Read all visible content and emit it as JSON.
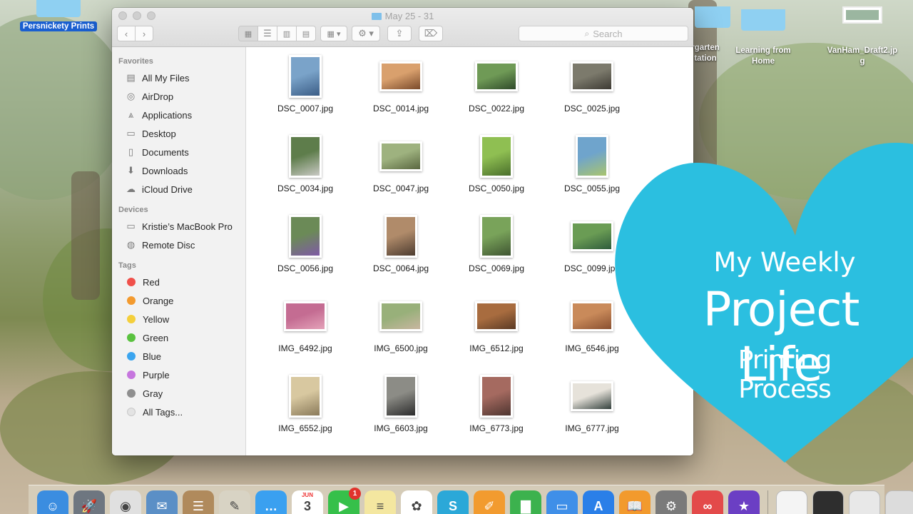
{
  "desktop": {
    "icons": [
      {
        "label": "Persnickety Prints",
        "selected": true
      },
      {
        "label": "rgarten\ntation"
      },
      {
        "label": "Learning from\nHome"
      },
      {
        "label": "VanHam_Draft2.jp\ng"
      }
    ]
  },
  "window": {
    "title": "May 25 - 31",
    "search_placeholder": "Search"
  },
  "sidebar": {
    "favorites_heading": "Favorites",
    "favorites": [
      {
        "label": "All My Files",
        "icon": "all-files-icon"
      },
      {
        "label": "AirDrop",
        "icon": "airdrop-icon"
      },
      {
        "label": "Applications",
        "icon": "applications-icon"
      },
      {
        "label": "Desktop",
        "icon": "desktop-icon"
      },
      {
        "label": "Documents",
        "icon": "documents-icon"
      },
      {
        "label": "Downloads",
        "icon": "downloads-icon"
      },
      {
        "label": "iCloud Drive",
        "icon": "icloud-icon"
      }
    ],
    "devices_heading": "Devices",
    "devices": [
      {
        "label": "Kristie’s MacBook Pro",
        "icon": "laptop-icon"
      },
      {
        "label": "Remote Disc",
        "icon": "disc-icon"
      }
    ],
    "tags_heading": "Tags",
    "tags": [
      {
        "label": "Red",
        "color": "#f0504a"
      },
      {
        "label": "Orange",
        "color": "#f39a2e"
      },
      {
        "label": "Yellow",
        "color": "#f4cf3b"
      },
      {
        "label": "Green",
        "color": "#5ac23f"
      },
      {
        "label": "Blue",
        "color": "#3ba5ef"
      },
      {
        "label": "Purple",
        "color": "#c676de"
      },
      {
        "label": "Gray",
        "color": "#8f8f8f"
      },
      {
        "label": "All Tags...",
        "color": "#e3e3e3"
      }
    ]
  },
  "files": [
    {
      "name": "DSC_0007.jpg",
      "orientation": "portrait",
      "colors": [
        "#7aa3c9",
        "#3b5d86"
      ]
    },
    {
      "name": "DSC_0014.jpg",
      "orientation": "landscape",
      "colors": [
        "#d9a06d",
        "#7a4a2b"
      ]
    },
    {
      "name": "DSC_0022.jpg",
      "orientation": "landscape",
      "colors": [
        "#6f9a56",
        "#2f4a2a"
      ]
    },
    {
      "name": "DSC_0025.jpg",
      "orientation": "landscape",
      "colors": [
        "#7c7a6c",
        "#3d3a33"
      ]
    },
    {
      "name": "DSC_0034.jpg",
      "orientation": "portrait",
      "colors": [
        "#5e7d4b",
        "#c9c9c4"
      ]
    },
    {
      "name": "DSC_0047.jpg",
      "orientation": "landscape",
      "colors": [
        "#9eb27f",
        "#5a6740"
      ]
    },
    {
      "name": "DSC_0050.jpg",
      "orientation": "portrait",
      "colors": [
        "#8fbf52",
        "#4a6f2c"
      ]
    },
    {
      "name": "DSC_0055.jpg",
      "orientation": "portrait",
      "colors": [
        "#6fa4cc",
        "#a9c46e"
      ]
    },
    {
      "name": "DSC_0056.jpg",
      "orientation": "portrait",
      "colors": [
        "#6b8a57",
        "#7f5aa6"
      ]
    },
    {
      "name": "DSC_0064.jpg",
      "orientation": "portrait",
      "colors": [
        "#b08b6a",
        "#4d3c30"
      ]
    },
    {
      "name": "DSC_0069.jpg",
      "orientation": "portrait",
      "colors": [
        "#79a35a",
        "#3f5532"
      ]
    },
    {
      "name": "DSC_0099.jpg",
      "orientation": "landscape",
      "colors": [
        "#6a9c54",
        "#2f5c3c"
      ]
    },
    {
      "name": "IMG_6492.jpg",
      "orientation": "landscape",
      "colors": [
        "#c46c92",
        "#e4a2b9"
      ]
    },
    {
      "name": "IMG_6500.jpg",
      "orientation": "landscape",
      "colors": [
        "#98b07a",
        "#c8b6a0"
      ]
    },
    {
      "name": "IMG_6512.jpg",
      "orientation": "landscape",
      "colors": [
        "#a86c3f",
        "#5a3a24"
      ]
    },
    {
      "name": "IMG_6546.jpg",
      "orientation": "landscape",
      "colors": [
        "#c98a5a",
        "#8a5030"
      ]
    },
    {
      "name": "IMG_6552.jpg",
      "orientation": "portrait",
      "colors": [
        "#d8c8a0",
        "#8a7a5a"
      ]
    },
    {
      "name": "IMG_6603.jpg",
      "orientation": "portrait",
      "colors": [
        "#8c8c86",
        "#2c2c2c"
      ]
    },
    {
      "name": "IMG_6773.jpg",
      "orientation": "portrait",
      "colors": [
        "#a56a60",
        "#4e3530"
      ]
    },
    {
      "name": "IMG_6777.jpg",
      "orientation": "landscape",
      "colors": [
        "#e6e2da",
        "#33403c"
      ]
    }
  ],
  "overlay": {
    "line1": "My Weekly",
    "line2": "Project Life",
    "line3": "Printing Process",
    "heart_color": "#2bbfe0"
  },
  "dock": {
    "apps": [
      {
        "name": "finder-app",
        "color": "#3b8de0",
        "glyph": "☺"
      },
      {
        "name": "launchpad-app",
        "color": "#6e7680",
        "glyph": "🚀"
      },
      {
        "name": "chrome-app",
        "color": "#e0e0e0",
        "glyph": "◉"
      },
      {
        "name": "mail-app",
        "color": "#5b8fc6",
        "glyph": "✉"
      },
      {
        "name": "contacts-app",
        "color": "#b08a5c",
        "glyph": "☰"
      },
      {
        "name": "notes-app",
        "color": "#d8d3c4",
        "glyph": "✎"
      },
      {
        "name": "messages-app",
        "color": "#3aa0f0",
        "glyph": "…"
      },
      {
        "name": "calendar-app",
        "color": "#ffffff",
        "glyph": "3",
        "label": "JUN"
      },
      {
        "name": "facetime-app",
        "color": "#36c04a",
        "glyph": "▶",
        "badge": "1"
      },
      {
        "name": "stickies-app",
        "color": "#f4e7a0",
        "glyph": "≡"
      },
      {
        "name": "photos-app",
        "color": "#ffffff",
        "glyph": "✿"
      },
      {
        "name": "silhouette-app",
        "color": "#2ba8d8",
        "glyph": "S"
      },
      {
        "name": "pages-app",
        "color": "#f29b2f",
        "glyph": "✐"
      },
      {
        "name": "numbers-app",
        "color": "#3cb24e",
        "glyph": "▇"
      },
      {
        "name": "keynote-app",
        "color": "#3f8fe8",
        "glyph": "▭"
      },
      {
        "name": "app-store-app",
        "color": "#2a7fe8",
        "glyph": "A"
      },
      {
        "name": "ibooks-app",
        "color": "#f29a2d",
        "glyph": "📖"
      },
      {
        "name": "system-prefs-app",
        "color": "#7a7a7a",
        "glyph": "⚙"
      },
      {
        "name": "creative-cloud-app",
        "color": "#e34a4a",
        "glyph": "∞"
      },
      {
        "name": "imovie-app",
        "color": "#6b3fc4",
        "glyph": "★"
      }
    ],
    "recent": [
      {
        "name": "doc-thumbnail-1",
        "color": "#f4f4f4"
      },
      {
        "name": "doc-thumbnail-2",
        "color": "#2e2e2e"
      },
      {
        "name": "doc-thumbnail-3",
        "color": "#e8e8e8"
      },
      {
        "name": "trash-app",
        "color": "#dcdcdc"
      }
    ]
  }
}
